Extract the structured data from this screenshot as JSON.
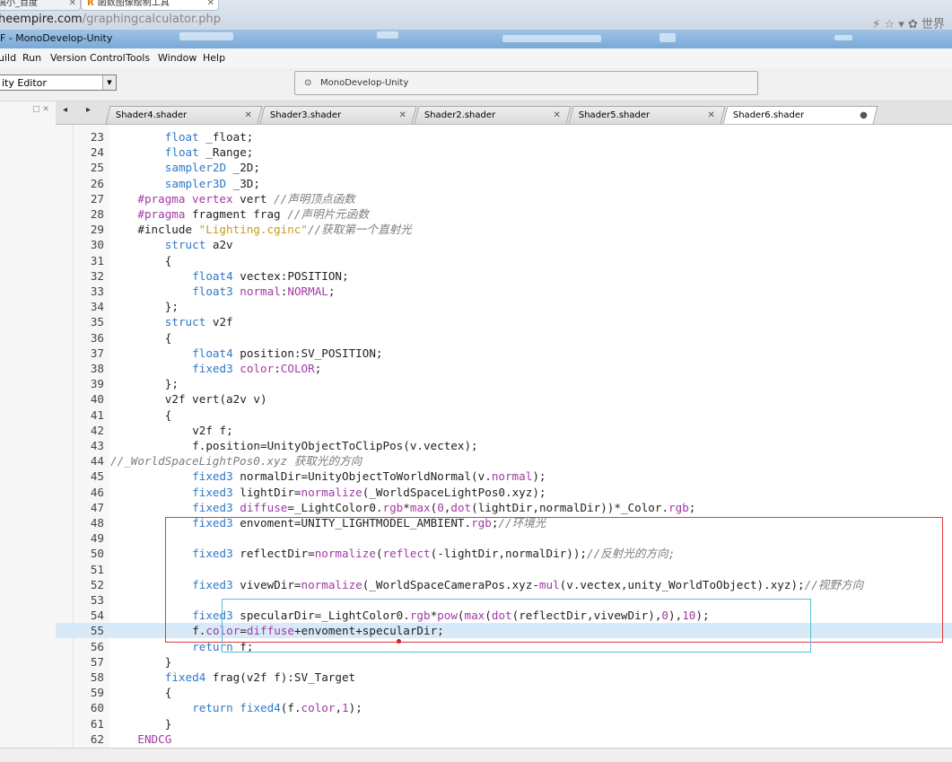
{
  "browser": {
    "tabs": [
      {
        "label": "线搞小_百度",
        "close": "✕"
      },
      {
        "label": "函数图像绘制工具",
        "close": "✕",
        "icon": "R"
      }
    ],
    "url": {
      "host": "heempire.com",
      "path": "/graphingcalculator.php"
    },
    "icons": [
      "⚡",
      "☆",
      "▾",
      "✿",
      "世界"
    ]
  },
  "window": {
    "title": "F - MonoDevelop-Unity"
  },
  "menu": [
    "uild",
    "Run",
    "Version Control",
    "Tools",
    "Window",
    "Help"
  ],
  "toolbar": {
    "target": "ity Editor",
    "status_text": "MonoDevelop-Unity"
  },
  "editor_tabs": [
    {
      "label": "Shader4.shader",
      "close": "✕"
    },
    {
      "label": "Shader3.shader",
      "close": "✕"
    },
    {
      "label": "Shader2.shader",
      "close": "✕"
    },
    {
      "label": "Shader5.shader",
      "close": "✕"
    },
    {
      "label": "Shader6.shader",
      "close": "●",
      "active": true
    }
  ],
  "nav": {
    "back": "◂",
    "forward": "▸",
    "panel": "□ ✕"
  },
  "code_lines": [
    {
      "n": "23",
      "indent": 8,
      "parts": [
        [
          "k",
          "float"
        ],
        [
          "t",
          " _float;"
        ]
      ]
    },
    {
      "n": "24",
      "indent": 8,
      "parts": [
        [
          "k",
          "float"
        ],
        [
          "t",
          " _Range;"
        ]
      ]
    },
    {
      "n": "25",
      "indent": 8,
      "parts": [
        [
          "k",
          "sampler2D"
        ],
        [
          "t",
          " _2D;"
        ]
      ]
    },
    {
      "n": "26",
      "indent": 8,
      "parts": [
        [
          "k",
          "sampler3D"
        ],
        [
          "t",
          " _3D;"
        ]
      ]
    },
    {
      "n": "27",
      "indent": 4,
      "parts": [
        [
          "m",
          "#pragma vertex"
        ],
        [
          "t",
          " vert "
        ],
        [
          "c",
          "//声明顶点函数"
        ]
      ]
    },
    {
      "n": "28",
      "indent": 4,
      "parts": [
        [
          "m",
          "#pragma"
        ],
        [
          "t",
          " fragment frag "
        ],
        [
          "c",
          "//声明片元函数"
        ]
      ]
    },
    {
      "n": "29",
      "indent": 4,
      "parts": [
        [
          "t",
          "#include "
        ],
        [
          "s",
          "\"Lighting.cginc\""
        ],
        [
          "c",
          "//获取第一个直射光"
        ]
      ]
    },
    {
      "n": "30",
      "indent": 8,
      "parts": [
        [
          "k",
          "struct"
        ],
        [
          "t",
          " a2v"
        ]
      ]
    },
    {
      "n": "31",
      "indent": 8,
      "parts": [
        [
          "t",
          "{"
        ]
      ]
    },
    {
      "n": "32",
      "indent": 12,
      "parts": [
        [
          "k",
          "float4"
        ],
        [
          "t",
          " vectex:POSITION;"
        ]
      ]
    },
    {
      "n": "33",
      "indent": 12,
      "parts": [
        [
          "k",
          "float3"
        ],
        [
          "t",
          " "
        ],
        [
          "n",
          "normal"
        ],
        [
          "t",
          ":"
        ],
        [
          "n",
          "NORMAL"
        ],
        [
          "t",
          ";"
        ]
      ]
    },
    {
      "n": "34",
      "indent": 8,
      "parts": [
        [
          "t",
          "};"
        ]
      ]
    },
    {
      "n": "35",
      "indent": 8,
      "parts": [
        [
          "k",
          "struct"
        ],
        [
          "t",
          " v2f"
        ]
      ]
    },
    {
      "n": "36",
      "indent": 8,
      "parts": [
        [
          "t",
          "{"
        ]
      ]
    },
    {
      "n": "37",
      "indent": 12,
      "parts": [
        [
          "k",
          "float4"
        ],
        [
          "t",
          " position:SV_POSITION;"
        ]
      ]
    },
    {
      "n": "38",
      "indent": 12,
      "parts": [
        [
          "k",
          "fixed3"
        ],
        [
          "t",
          " "
        ],
        [
          "n",
          "color"
        ],
        [
          "t",
          ":"
        ],
        [
          "n",
          "COLOR"
        ],
        [
          "t",
          ";"
        ]
      ]
    },
    {
      "n": "39",
      "indent": 8,
      "parts": [
        [
          "t",
          "};"
        ]
      ]
    },
    {
      "n": "40",
      "indent": 8,
      "parts": [
        [
          "t",
          "v2f vert(a2v v)"
        ]
      ]
    },
    {
      "n": "41",
      "indent": 8,
      "parts": [
        [
          "t",
          "{"
        ]
      ]
    },
    {
      "n": "42",
      "indent": 12,
      "parts": [
        [
          "t",
          "v2f f;"
        ]
      ]
    },
    {
      "n": "43",
      "indent": 12,
      "parts": [
        [
          "t",
          "f.position=UnityObjectToClipPos(v.vectex);"
        ]
      ]
    },
    {
      "n": "44",
      "indent": 0,
      "parts": [
        [
          "c",
          "//_WorldSpaceLightPos0.xyz 获取光的方向"
        ]
      ]
    },
    {
      "n": "45",
      "indent": 12,
      "parts": [
        [
          "k",
          "fixed3"
        ],
        [
          "t",
          " normalDir=UnityObjectToWorldNormal(v."
        ],
        [
          "n",
          "normal"
        ],
        [
          "t",
          ");"
        ]
      ]
    },
    {
      "n": "46",
      "indent": 12,
      "parts": [
        [
          "k",
          "fixed3"
        ],
        [
          "t",
          " lightDir="
        ],
        [
          "f",
          "normalize"
        ],
        [
          "t",
          "(_WorldSpaceLightPos0.xyz);"
        ]
      ]
    },
    {
      "n": "47",
      "indent": 12,
      "parts": [
        [
          "k",
          "fixed3"
        ],
        [
          "t",
          " "
        ],
        [
          "n",
          "diffuse"
        ],
        [
          "t",
          "=_LightColor0."
        ],
        [
          "n",
          "rgb"
        ],
        [
          "t",
          "*"
        ],
        [
          "f",
          "max"
        ],
        [
          "t",
          "("
        ],
        [
          "m",
          "0"
        ],
        [
          "t",
          ","
        ],
        [
          "f",
          "dot"
        ],
        [
          "t",
          "(lightDir,normalDir))*_Color."
        ],
        [
          "n",
          "rgb"
        ],
        [
          "t",
          ";"
        ]
      ]
    },
    {
      "n": "48",
      "indent": 12,
      "parts": [
        [
          "k",
          "fixed3"
        ],
        [
          "t",
          " envoment=UNITY_LIGHTMODEL_AMBIENT."
        ],
        [
          "n",
          "rgb"
        ],
        [
          "t",
          ";"
        ],
        [
          "c",
          "//环境光"
        ]
      ]
    },
    {
      "n": "49",
      "indent": 0,
      "parts": []
    },
    {
      "n": "50",
      "indent": 12,
      "parts": [
        [
          "k",
          "fixed3"
        ],
        [
          "t",
          " reflectDir="
        ],
        [
          "f",
          "normalize"
        ],
        [
          "t",
          "("
        ],
        [
          "f",
          "reflect"
        ],
        [
          "t",
          "(-lightDir,normalDir));"
        ],
        [
          "c",
          "//反射光的方向;"
        ]
      ]
    },
    {
      "n": "51",
      "indent": 0,
      "parts": []
    },
    {
      "n": "52",
      "indent": 12,
      "parts": [
        [
          "k",
          "fixed3"
        ],
        [
          "t",
          " vivewDir="
        ],
        [
          "f",
          "normalize"
        ],
        [
          "t",
          "(_WorldSpaceCameraPos.xyz-"
        ],
        [
          "f",
          "mul"
        ],
        [
          "t",
          "(v.vectex,unity_WorldToObject).xyz);"
        ],
        [
          "c",
          "//视野方向"
        ]
      ]
    },
    {
      "n": "53",
      "indent": 0,
      "parts": []
    },
    {
      "n": "54",
      "indent": 12,
      "parts": [
        [
          "k",
          "fixed3"
        ],
        [
          "t",
          " specularDir=_LightColor0."
        ],
        [
          "n",
          "rgb"
        ],
        [
          "t",
          "*"
        ],
        [
          "f",
          "pow"
        ],
        [
          "t",
          "("
        ],
        [
          "f",
          "max"
        ],
        [
          "t",
          "("
        ],
        [
          "f",
          "dot"
        ],
        [
          "t",
          "(reflectDir,vivewDir),"
        ],
        [
          "m",
          "0"
        ],
        [
          "t",
          "),"
        ],
        [
          "m",
          "10"
        ],
        [
          "t",
          ");"
        ]
      ]
    },
    {
      "n": "55",
      "indent": 12,
      "parts": [
        [
          "t",
          "f."
        ],
        [
          "n",
          "color"
        ],
        [
          "t",
          "="
        ],
        [
          "n",
          "diffuse"
        ],
        [
          "t",
          "+envoment+specularDir;"
        ]
      ]
    },
    {
      "n": "56",
      "indent": 12,
      "parts": [
        [
          "k",
          "return"
        ],
        [
          "t",
          " f;"
        ]
      ]
    },
    {
      "n": "57",
      "indent": 8,
      "parts": [
        [
          "t",
          "}"
        ]
      ]
    },
    {
      "n": "58",
      "indent": 8,
      "parts": [
        [
          "k",
          "fixed4"
        ],
        [
          "t",
          " frag(v2f f):SV_Target"
        ]
      ]
    },
    {
      "n": "59",
      "indent": 8,
      "parts": [
        [
          "t",
          "{"
        ]
      ]
    },
    {
      "n": "60",
      "indent": 12,
      "parts": [
        [
          "k",
          "return"
        ],
        [
          "t",
          " "
        ],
        [
          "k",
          "fixed4"
        ],
        [
          "t",
          "(f."
        ],
        [
          "n",
          "color"
        ],
        [
          "t",
          ","
        ],
        [
          "m",
          "1"
        ],
        [
          "t",
          ");"
        ]
      ]
    },
    {
      "n": "61",
      "indent": 8,
      "parts": [
        [
          "t",
          "}"
        ]
      ]
    },
    {
      "n": "62",
      "indent": 4,
      "parts": [
        [
          "m",
          "ENDCG"
        ]
      ]
    }
  ],
  "highlight_line": "55"
}
